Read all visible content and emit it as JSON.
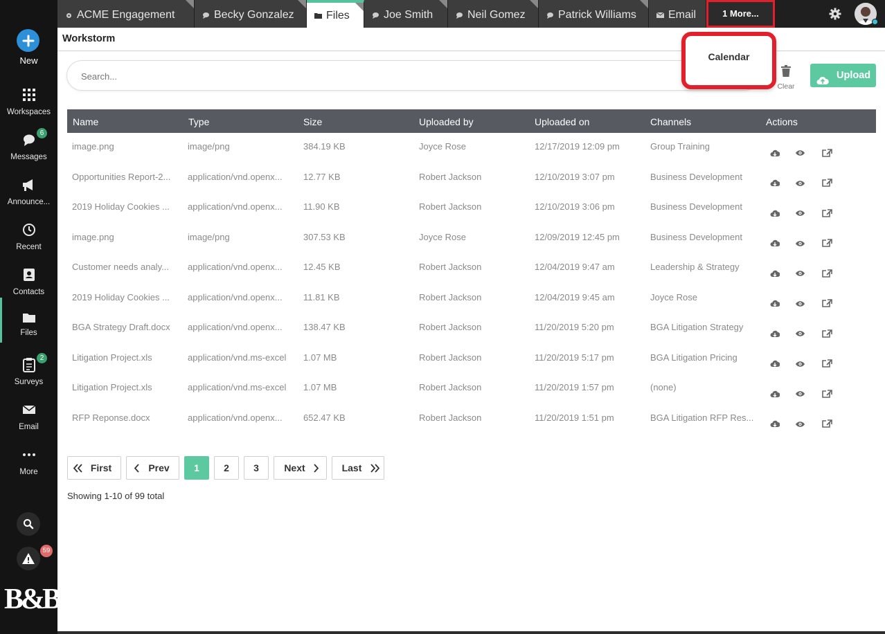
{
  "sidebar": {
    "new_label": "New",
    "items": [
      {
        "label": "Workspaces",
        "icon": "grid-icon"
      },
      {
        "label": "Messages",
        "icon": "chat-icon",
        "badge": "6"
      },
      {
        "label": "Announce...",
        "icon": "megaphone-icon"
      },
      {
        "label": "Recent",
        "icon": "clock-icon"
      },
      {
        "label": "Contacts",
        "icon": "contacts-icon"
      },
      {
        "label": "Files",
        "icon": "folder-icon"
      },
      {
        "label": "Surveys",
        "icon": "clipboard-icon",
        "badge": "2"
      },
      {
        "label": "Email",
        "icon": "envelope-icon"
      },
      {
        "label": "More",
        "icon": "dots-icon"
      }
    ],
    "alert_count": "59",
    "logo_text": "B&B"
  },
  "tabs": [
    {
      "label": "ACME Engagement",
      "icon": "gear-icon"
    },
    {
      "label": "Becky Gonzalez",
      "icon": "chat-icon"
    },
    {
      "label": "Files",
      "icon": "folder-icon"
    },
    {
      "label": "Joe Smith",
      "icon": "chat-icon"
    },
    {
      "label": "Neil Gomez",
      "icon": "chat-icon"
    },
    {
      "label": "Patrick Williams",
      "icon": "chat-icon"
    },
    {
      "label": "Email",
      "icon": "envelope-icon"
    }
  ],
  "more_tab_label": "1 More...",
  "dropdown_item": "Calendar",
  "workspace_title": "Workstorm",
  "search": {
    "placeholder": "Search..."
  },
  "clear_label": "Clear",
  "upload_label": "Upload",
  "table": {
    "headers": [
      "Name",
      "Type",
      "Size",
      "Uploaded by",
      "Uploaded on",
      "Channels",
      "Actions"
    ],
    "rows": [
      [
        "image.png",
        "image/png",
        "384.19 KB",
        "Joyce Rose",
        "12/17/2019 12:09 pm",
        "Group Training"
      ],
      [
        "Opportunities Report-2...",
        "application/vnd.openx...",
        "12.77 KB",
        "Robert Jackson",
        "12/10/2019 3:07 pm",
        "Business Development"
      ],
      [
        "2019 Holiday Cookies ...",
        "application/vnd.openx...",
        "11.90 KB",
        "Robert Jackson",
        "12/10/2019 3:06 pm",
        "Business Development"
      ],
      [
        "image.png",
        "image/png",
        "307.53 KB",
        "Joyce Rose",
        "12/09/2019 12:45 pm",
        "Business Development"
      ],
      [
        "Customer needs analy...",
        "application/vnd.openx...",
        "12.45 KB",
        "Robert Jackson",
        "12/04/2019 9:47 am",
        "Leadership & Strategy"
      ],
      [
        "2019 Holiday Cookies ...",
        "application/vnd.openx...",
        "11.81 KB",
        "Robert Jackson",
        "12/04/2019 9:45 am",
        "Joyce Rose"
      ],
      [
        "BGA Strategy Draft.docx",
        "application/vnd.openx...",
        "138.47 KB",
        "Robert Jackson",
        "11/20/2019 5:20 pm",
        "BGA Litigation Strategy"
      ],
      [
        "Litigation Project.xls",
        "application/vnd.ms-excel",
        "1.07 MB",
        "Robert Jackson",
        "11/20/2019 5:17 pm",
        "BGA Litigation Pricing"
      ],
      [
        "Litigation Project.xls",
        "application/vnd.ms-excel",
        "1.07 MB",
        "Robert Jackson",
        "11/20/2019 1:57 pm",
        "(none)"
      ],
      [
        "RFP Reponse.docx",
        "application/vnd.openx...",
        "652.47 KB",
        "Robert Jackson",
        "11/20/2019 1:51 pm",
        "BGA Litigation RFP Res..."
      ]
    ]
  },
  "pagination": {
    "first": "First",
    "prev": "Prev",
    "pages": [
      "1",
      "2",
      "3"
    ],
    "current": "1",
    "next": "Next",
    "last": "Last",
    "showing": "Showing 1-10 of 99 total"
  },
  "colors": {
    "accent": "#5cc9a1",
    "highlight": "#e0202a",
    "new_button": "#2d8fd8"
  }
}
